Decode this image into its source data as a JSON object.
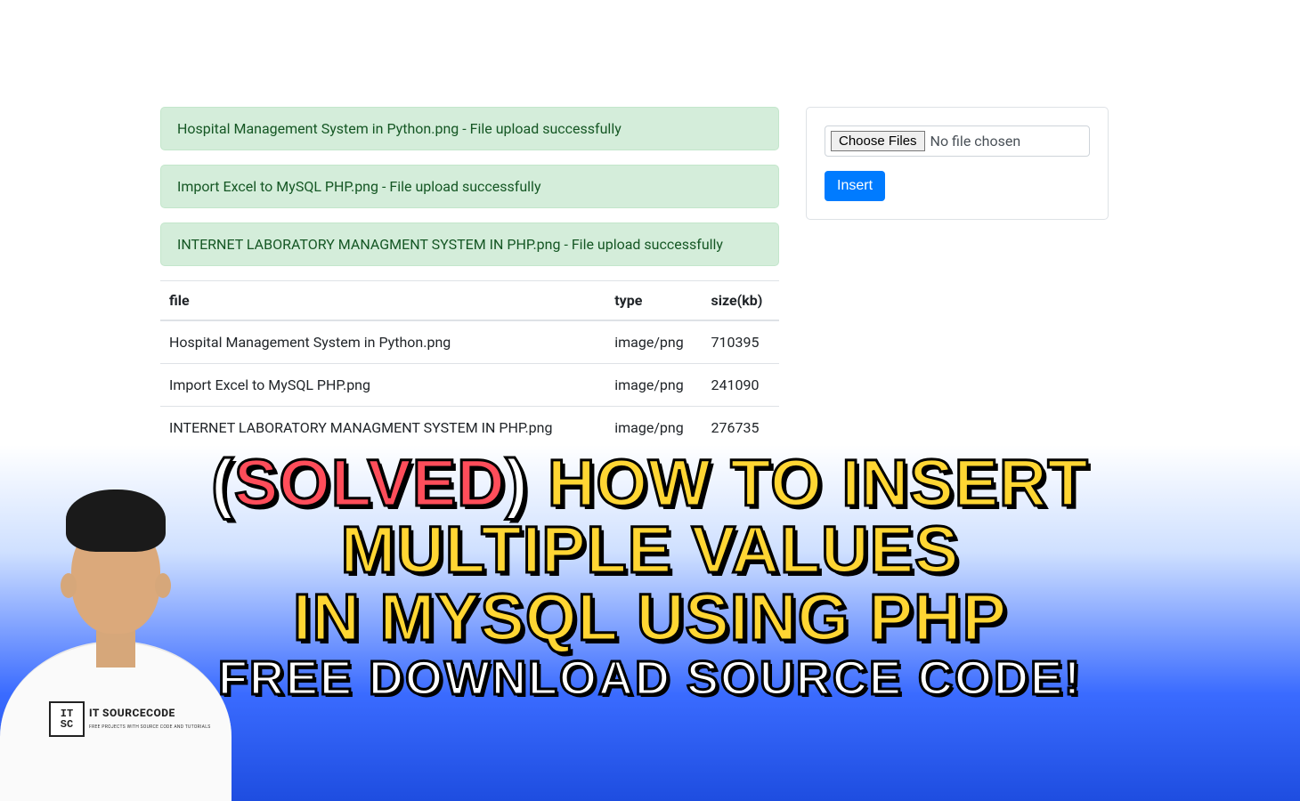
{
  "alerts": [
    "Hospital Management System in Python.png - File upload successfully",
    "Import Excel to MySQL PHP.png - File upload successfully",
    "INTERNET LABORATORY MANAGMENT SYSTEM IN PHP.png - File upload successfully"
  ],
  "table": {
    "headers": {
      "file": "file",
      "type": "type",
      "size": "size(kb)"
    },
    "rows": [
      {
        "file": "Hospital Management System in Python.png",
        "type": "image/png",
        "size": "710395"
      },
      {
        "file": "Import Excel to MySQL PHP.png",
        "type": "image/png",
        "size": "241090"
      },
      {
        "file": "INTERNET LABORATORY MANAGMENT SYSTEM IN PHP.png",
        "type": "image/png",
        "size": "276735"
      }
    ]
  },
  "form": {
    "choose_label": "Choose Files",
    "no_file_label": "No file chosen",
    "submit_label": "Insert"
  },
  "headline": {
    "open_paren": "(",
    "solved": "SOLVED",
    "close_paren": ")",
    "line1_rest": " HOW TO INSERT",
    "line2": "MULTIPLE VALUES",
    "line3": "IN MYSQL USING PHP",
    "sub": "FREE DOWNLOAD SOURCE CODE!"
  },
  "shirt": {
    "logo_line1": "IT",
    "logo_line2": "SC",
    "brand": "IT SOURCECODE",
    "tagline": "FREE PROJECTS WITH SOURCE CODE AND TUTORIALS"
  }
}
